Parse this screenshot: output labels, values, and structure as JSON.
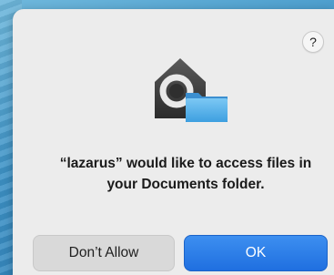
{
  "dialog": {
    "help_label": "?",
    "message": "“lazarus” would like to access files in your Documents folder.",
    "deny_label": "Don’t Allow",
    "allow_label": "OK",
    "icon_name": "privacy-house-folder-icon"
  },
  "colors": {
    "primary_button": "#1f6fe0",
    "dialog_background": "#ececec",
    "folder_blue": "#5ab4ec"
  }
}
